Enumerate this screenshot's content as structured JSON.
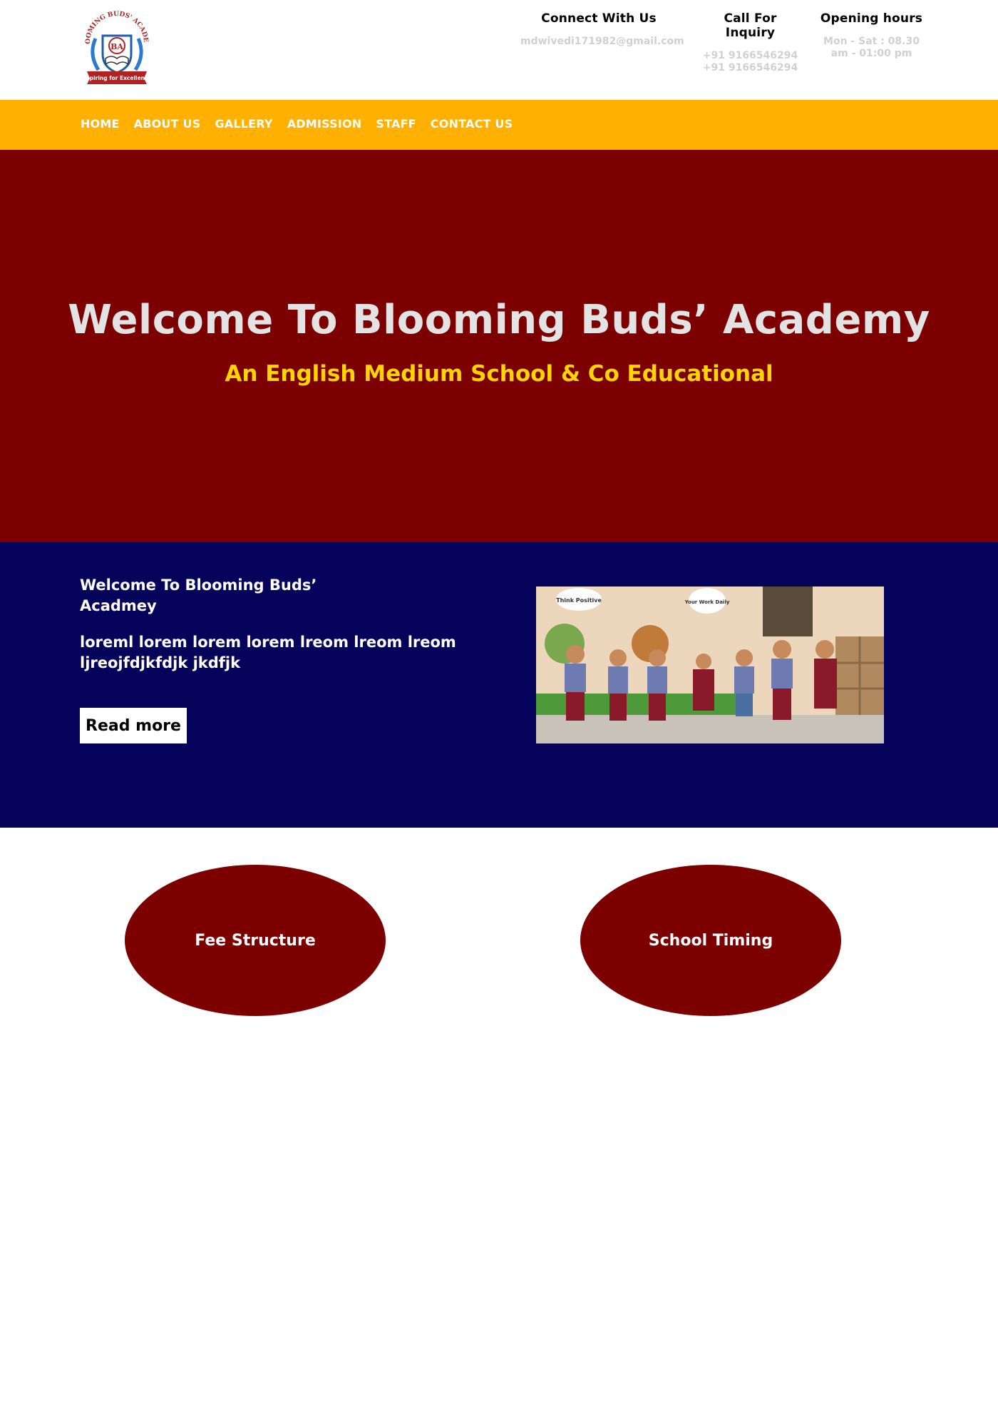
{
  "header": {
    "logo": {
      "top_text": "BLOOMING BUDS' ACADEMY",
      "ribbon_text": "Aspiring for Excellence",
      "monogram": "BA"
    },
    "contact": [
      {
        "heading": "Connect With Us",
        "lines": [
          "mdwivedi171982@gmail.com"
        ]
      },
      {
        "heading": "Call For Inquiry",
        "lines": [
          "+91 9166546294",
          "+91 9166546294"
        ]
      },
      {
        "heading": "Opening hours",
        "lines": [
          "Mon - Sat : 08.30",
          "am - 01:00 pm"
        ]
      }
    ]
  },
  "nav": {
    "items": [
      "HOME",
      "ABOUT US",
      "GALLERY",
      "ADMISSION",
      "STAFF",
      "CONTACT US"
    ]
  },
  "hero": {
    "title": "Welcome To Blooming Buds’ Academy",
    "subtitle": "An English Medium School & Co Educational"
  },
  "about": {
    "title": "Welcome To Blooming Buds’\n Acadmey",
    "text": "loreml lorem lorem lorem lreom lreom lreom ljreojfdjkfdjk jkdfjk",
    "button": "Read more",
    "photo_bubbles": [
      "Think Positive",
      "Your Work Daily"
    ]
  },
  "features": {
    "fee": "Fee Structure",
    "timing": "School Timing"
  },
  "colors": {
    "nav_bg": "#ffb000",
    "hero_bg": "#7d0000",
    "about_bg": "#05045a",
    "subtitle": "#ffd400",
    "oval": "#7d0000"
  }
}
